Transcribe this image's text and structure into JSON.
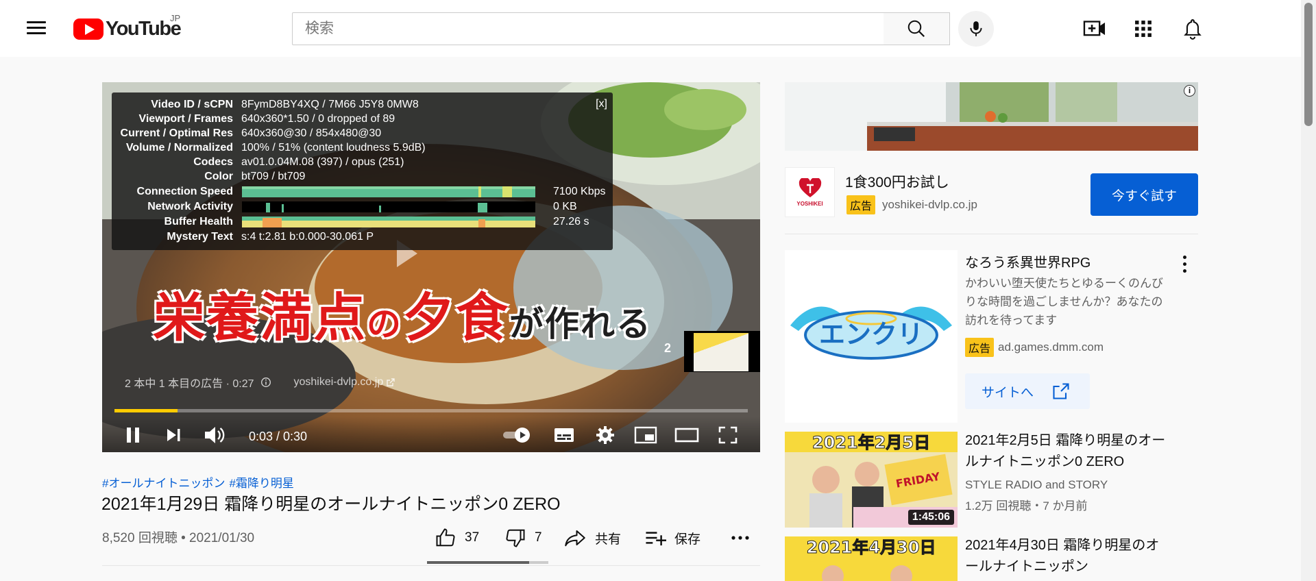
{
  "header": {
    "logo_text": "YouTube",
    "region": "JP",
    "search_placeholder": "検索"
  },
  "stats": {
    "close_label": "[x]",
    "rows": [
      {
        "label": "Video ID / sCPN",
        "value": "8FymD8BY4XQ / 7M66 J5Y8 0MW8"
      },
      {
        "label": "Viewport / Frames",
        "value": "640x360*1.50 / 0 dropped of 89"
      },
      {
        "label": "Current / Optimal Res",
        "value": "640x360@30 / 854x480@30"
      },
      {
        "label": "Volume / Normalized",
        "value": "100% / 51% (content loudness 5.9dB)"
      },
      {
        "label": "Codecs",
        "value": "av01.0.04M.08 (397) / opus (251)"
      },
      {
        "label": "Color",
        "value": "bt709 / bt709"
      },
      {
        "label": "Connection Speed",
        "value": "7100 Kbps"
      },
      {
        "label": "Network Activity",
        "value": "0 KB"
      },
      {
        "label": "Buffer Health",
        "value": "27.26 s"
      },
      {
        "label": "Mystery Text",
        "value": "s:4 t:2.81 b:0.000-30.061 P"
      }
    ]
  },
  "player": {
    "overlay_title_main": "栄養満点",
    "overlay_title_no": "の",
    "overlay_title_2": "夕食",
    "overlay_title_tail": "が作れる",
    "ad_count_badge": "2",
    "ad_info": "2 本中 1 本目の広告 · 0:27",
    "ad_link": "yoshikei-dvlp.co.jp",
    "time": "0:03 / 0:30",
    "progress": 0.1
  },
  "video": {
    "hashtags": [
      "#オールナイトニッポン",
      "#霜降り明星"
    ],
    "title": "2021年1月29日 霜降り明星のオールナイトニッポン0 ZERO",
    "meta": "8,520 回視聴 • 2021/01/30",
    "likes": "37",
    "dislikes": "7",
    "share_label": "共有",
    "save_label": "保存",
    "like_ratio": 0.84
  },
  "sidebar": {
    "ad1": {
      "logo_brand": "YOSHIKEI",
      "headline": "1食300円お試し",
      "badge": "広告",
      "domain": "yoshikei-dvlp.co.jp",
      "cta": "今すぐ試す"
    },
    "ad2": {
      "thumb_text": "エンクリ",
      "title": "なろう系異世界RPG",
      "description": "かわいい堕天使たちとゆるーくのんびりな時間を過ごしませんか？あなたの訪れを待ってます",
      "badge": "広告",
      "domain": "ad.games.dmm.com",
      "site_button": "サイトへ"
    },
    "recs": [
      {
        "thumb_text": "2021年2月5日",
        "title": "2021年2月5日 霜降り明星のオールナイトニッポン0 ZERO",
        "channel": "STYLE RADIO and STORY",
        "stats": "1.2万 回視聴・7 か月前",
        "duration": "1:45:06"
      },
      {
        "thumb_text": "2021年4月30日",
        "title": "2021年4月30日 霜降り明星のオールナイトニッポン"
      }
    ]
  },
  "colors": {
    "brand_red": "#ff0000",
    "link_blue": "#065fd4",
    "ad_yellow": "#f9c21a",
    "progress_yellow": "#ffcc00"
  }
}
